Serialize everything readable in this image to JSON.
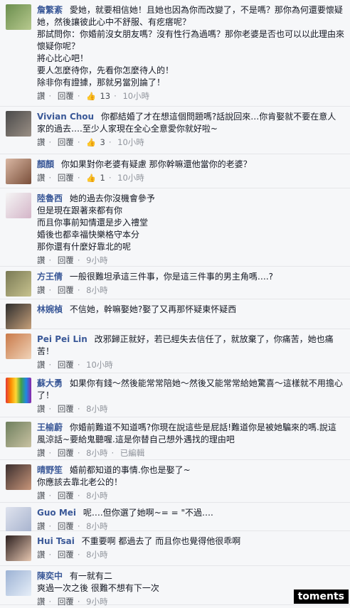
{
  "actions": {
    "like": "讚",
    "reply": "回覆",
    "edited": "已編輯"
  },
  "icons": {
    "like": "thumbs-up-icon"
  },
  "watermark": "toments",
  "comments": [
    {
      "name": "詹繁紊",
      "text": "愛她，就要相信她！且她也因為你而改變了，不是嗎？那你為何還要懷疑她，然後讓彼此心中不舒服、有疙瘩呢？\n那試問你：你婚前沒女朋友嗎？沒有性行為過嗎？那你老婆是否也可以以此理由來懷疑你呢？\n將心比心吧！\n要人怎麼待你，先看你怎麼待人的！\n除非你有證據，那就另當別論了！",
      "likes": "13",
      "time": "10小時"
    },
    {
      "name": "Vivian Chou",
      "text": "你都結婚了才在想這個問題嗎?話說回來…你肯娶就不要在意人家的過去….至少人家現在全心全意愛你就好啦~",
      "likes": "3",
      "time": "10小時"
    },
    {
      "name": "顏顏",
      "text": "你如果對你老婆有疑慮 那你幹嘛還他當你的老婆？",
      "likes": "1",
      "time": "10小時"
    },
    {
      "name": "陸魯西",
      "text": "她的過去你沒機會參予\n但是現在跟著來都有你\n而且你事前知情還是步入禮堂\n婚後也都幸福快樂格守本分\n那你還有什麼好靠北的呢",
      "likes": "",
      "time": "9小時"
    },
    {
      "name": "方王倩",
      "text": "一般很難坦承這三件事，你是這三件事的男主角嗎….?",
      "likes": "",
      "time": "8小時"
    },
    {
      "name": "林婉楨",
      "text": "不信她，幹嘛娶她?娶了又再那怀疑東怀疑西",
      "likes": "",
      "time": ""
    },
    {
      "name": "Pei Pei Lin",
      "text": "改邪歸正就好，若已經失去信任了，就放棄了，你痛苦，她也痛苦！",
      "likes": "",
      "time": "10小時"
    },
    {
      "name": "蘇大勇",
      "text": "如果你有錢～然後能常常陪她～然後又能常常給她驚喜～這樣就不用擔心了！",
      "likes": "",
      "time": "8小時"
    },
    {
      "name": "王榆蔚",
      "text": "你婚前難道不知道嗎?你現在說這些是屁話!難道你是被她騙來的嗎.說這風涼話~要給鬼聽喔.這是你替自己想外遇找的理由吧",
      "likes": "",
      "time": "8小時",
      "edited": true
    },
    {
      "name": "晴野笙",
      "text": "婚前都知道的事情.你也是娶了~\n你應該去靠北老公的！",
      "likes": "",
      "time": "8小時"
    },
    {
      "name": "Guo Mei",
      "text": "呢….但你選了她啊~= = \"不過….",
      "likes": "",
      "time": "8小時"
    },
    {
      "name": "Hui Tsai",
      "text": "不重要啊 都過去了 而且你也覺得他很乖啊",
      "likes": "",
      "time": "8小時"
    },
    {
      "name": "陳奕中",
      "text": "有一就有二\n爽過一次之後 很難不想有下一次",
      "likes": "",
      "time": "9小時"
    }
  ]
}
